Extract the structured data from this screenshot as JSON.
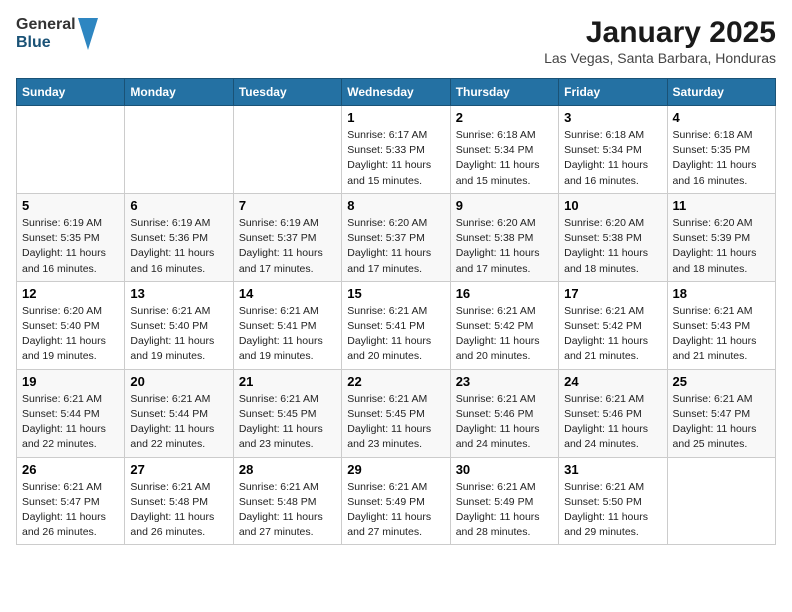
{
  "header": {
    "logo_general": "General",
    "logo_blue": "Blue",
    "title": "January 2025",
    "location": "Las Vegas, Santa Barbara, Honduras"
  },
  "days_of_week": [
    "Sunday",
    "Monday",
    "Tuesday",
    "Wednesday",
    "Thursday",
    "Friday",
    "Saturday"
  ],
  "weeks": [
    [
      {
        "num": "",
        "info": ""
      },
      {
        "num": "",
        "info": ""
      },
      {
        "num": "",
        "info": ""
      },
      {
        "num": "1",
        "info": "Sunrise: 6:17 AM\nSunset: 5:33 PM\nDaylight: 11 hours\nand 15 minutes."
      },
      {
        "num": "2",
        "info": "Sunrise: 6:18 AM\nSunset: 5:34 PM\nDaylight: 11 hours\nand 15 minutes."
      },
      {
        "num": "3",
        "info": "Sunrise: 6:18 AM\nSunset: 5:34 PM\nDaylight: 11 hours\nand 16 minutes."
      },
      {
        "num": "4",
        "info": "Sunrise: 6:18 AM\nSunset: 5:35 PM\nDaylight: 11 hours\nand 16 minutes."
      }
    ],
    [
      {
        "num": "5",
        "info": "Sunrise: 6:19 AM\nSunset: 5:35 PM\nDaylight: 11 hours\nand 16 minutes."
      },
      {
        "num": "6",
        "info": "Sunrise: 6:19 AM\nSunset: 5:36 PM\nDaylight: 11 hours\nand 16 minutes."
      },
      {
        "num": "7",
        "info": "Sunrise: 6:19 AM\nSunset: 5:37 PM\nDaylight: 11 hours\nand 17 minutes."
      },
      {
        "num": "8",
        "info": "Sunrise: 6:20 AM\nSunset: 5:37 PM\nDaylight: 11 hours\nand 17 minutes."
      },
      {
        "num": "9",
        "info": "Sunrise: 6:20 AM\nSunset: 5:38 PM\nDaylight: 11 hours\nand 17 minutes."
      },
      {
        "num": "10",
        "info": "Sunrise: 6:20 AM\nSunset: 5:38 PM\nDaylight: 11 hours\nand 18 minutes."
      },
      {
        "num": "11",
        "info": "Sunrise: 6:20 AM\nSunset: 5:39 PM\nDaylight: 11 hours\nand 18 minutes."
      }
    ],
    [
      {
        "num": "12",
        "info": "Sunrise: 6:20 AM\nSunset: 5:40 PM\nDaylight: 11 hours\nand 19 minutes."
      },
      {
        "num": "13",
        "info": "Sunrise: 6:21 AM\nSunset: 5:40 PM\nDaylight: 11 hours\nand 19 minutes."
      },
      {
        "num": "14",
        "info": "Sunrise: 6:21 AM\nSunset: 5:41 PM\nDaylight: 11 hours\nand 19 minutes."
      },
      {
        "num": "15",
        "info": "Sunrise: 6:21 AM\nSunset: 5:41 PM\nDaylight: 11 hours\nand 20 minutes."
      },
      {
        "num": "16",
        "info": "Sunrise: 6:21 AM\nSunset: 5:42 PM\nDaylight: 11 hours\nand 20 minutes."
      },
      {
        "num": "17",
        "info": "Sunrise: 6:21 AM\nSunset: 5:42 PM\nDaylight: 11 hours\nand 21 minutes."
      },
      {
        "num": "18",
        "info": "Sunrise: 6:21 AM\nSunset: 5:43 PM\nDaylight: 11 hours\nand 21 minutes."
      }
    ],
    [
      {
        "num": "19",
        "info": "Sunrise: 6:21 AM\nSunset: 5:44 PM\nDaylight: 11 hours\nand 22 minutes."
      },
      {
        "num": "20",
        "info": "Sunrise: 6:21 AM\nSunset: 5:44 PM\nDaylight: 11 hours\nand 22 minutes."
      },
      {
        "num": "21",
        "info": "Sunrise: 6:21 AM\nSunset: 5:45 PM\nDaylight: 11 hours\nand 23 minutes."
      },
      {
        "num": "22",
        "info": "Sunrise: 6:21 AM\nSunset: 5:45 PM\nDaylight: 11 hours\nand 23 minutes."
      },
      {
        "num": "23",
        "info": "Sunrise: 6:21 AM\nSunset: 5:46 PM\nDaylight: 11 hours\nand 24 minutes."
      },
      {
        "num": "24",
        "info": "Sunrise: 6:21 AM\nSunset: 5:46 PM\nDaylight: 11 hours\nand 24 minutes."
      },
      {
        "num": "25",
        "info": "Sunrise: 6:21 AM\nSunset: 5:47 PM\nDaylight: 11 hours\nand 25 minutes."
      }
    ],
    [
      {
        "num": "26",
        "info": "Sunrise: 6:21 AM\nSunset: 5:47 PM\nDaylight: 11 hours\nand 26 minutes."
      },
      {
        "num": "27",
        "info": "Sunrise: 6:21 AM\nSunset: 5:48 PM\nDaylight: 11 hours\nand 26 minutes."
      },
      {
        "num": "28",
        "info": "Sunrise: 6:21 AM\nSunset: 5:48 PM\nDaylight: 11 hours\nand 27 minutes."
      },
      {
        "num": "29",
        "info": "Sunrise: 6:21 AM\nSunset: 5:49 PM\nDaylight: 11 hours\nand 27 minutes."
      },
      {
        "num": "30",
        "info": "Sunrise: 6:21 AM\nSunset: 5:49 PM\nDaylight: 11 hours\nand 28 minutes."
      },
      {
        "num": "31",
        "info": "Sunrise: 6:21 AM\nSunset: 5:50 PM\nDaylight: 11 hours\nand 29 minutes."
      },
      {
        "num": "",
        "info": ""
      }
    ]
  ]
}
